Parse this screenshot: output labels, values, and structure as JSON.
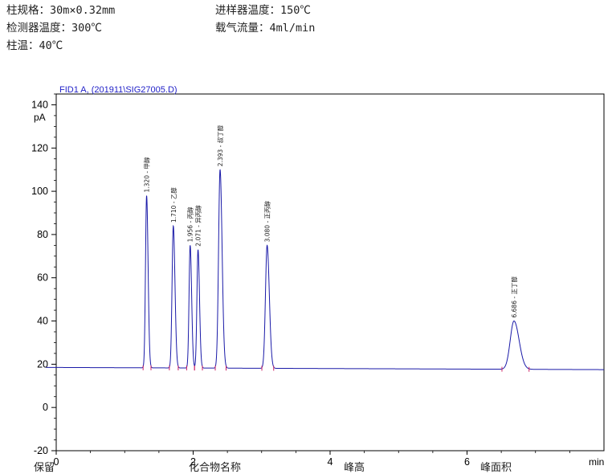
{
  "conditions": {
    "column": "柱规格：30m×0.32mm",
    "injector": "进样器温度：150℃",
    "detector": "检测器温度：300℃",
    "carrier": "载气流量：4ml/min",
    "oven": "柱温：40℃"
  },
  "footer_fragments": [
    "保留",
    "化合物名称",
    "峰高",
    "峰面积"
  ],
  "chart_data": {
    "type": "line",
    "title": "FID1 A,  (201911\\SIG27005.D)",
    "ylabel": "pA",
    "xlabel": "min",
    "xlim": [
      0,
      8.0
    ],
    "ylim": [
      -20,
      145
    ],
    "x_ticks": [
      0,
      2,
      4,
      6
    ],
    "y_ticks": [
      -20,
      0,
      20,
      40,
      60,
      80,
      100,
      120,
      140
    ],
    "grid": false,
    "line_color": "#1a1aa8",
    "title_color": "#2020c8",
    "label_color": "#202020",
    "baseline": {
      "start": 18.5,
      "end": 17.5
    },
    "peaks": [
      {
        "rt": 1.32,
        "label": "1.320",
        "name": "甲醇",
        "height": 98,
        "width": 0.016
      },
      {
        "rt": 1.71,
        "label": "1.710",
        "name": "乙醇",
        "height": 84,
        "width": 0.018
      },
      {
        "rt": 1.956,
        "label": "1.956",
        "name": "丙醇",
        "height": 75,
        "width": 0.016
      },
      {
        "rt": 2.071,
        "label": "2.071",
        "name": "异丙醇",
        "height": 73,
        "width": 0.016
      },
      {
        "rt": 2.393,
        "label": "2.393",
        "name": "叔丁醇",
        "height": 110,
        "width": 0.022
      },
      {
        "rt": 3.08,
        "label": "3.080",
        "name": "正丙醇",
        "height": 75,
        "width": 0.024
      },
      {
        "rt": 6.686,
        "label": "6.686",
        "name": "正丁醇",
        "height": 40,
        "width": 0.055
      }
    ]
  }
}
